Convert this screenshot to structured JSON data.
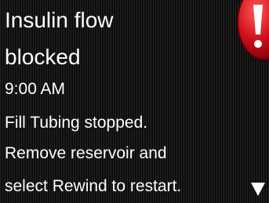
{
  "alert": {
    "title_line1": "Insulin flow",
    "title_line2": "blocked",
    "time": "9:00 AM",
    "message_lines": [
      "Fill Tubing stopped.",
      "Remove reservoir and",
      "select Rewind to restart."
    ],
    "icon": "alert-exclamation-icon",
    "icon_color": "#d0101b",
    "scroll_icon": "down-triangle-icon"
  }
}
